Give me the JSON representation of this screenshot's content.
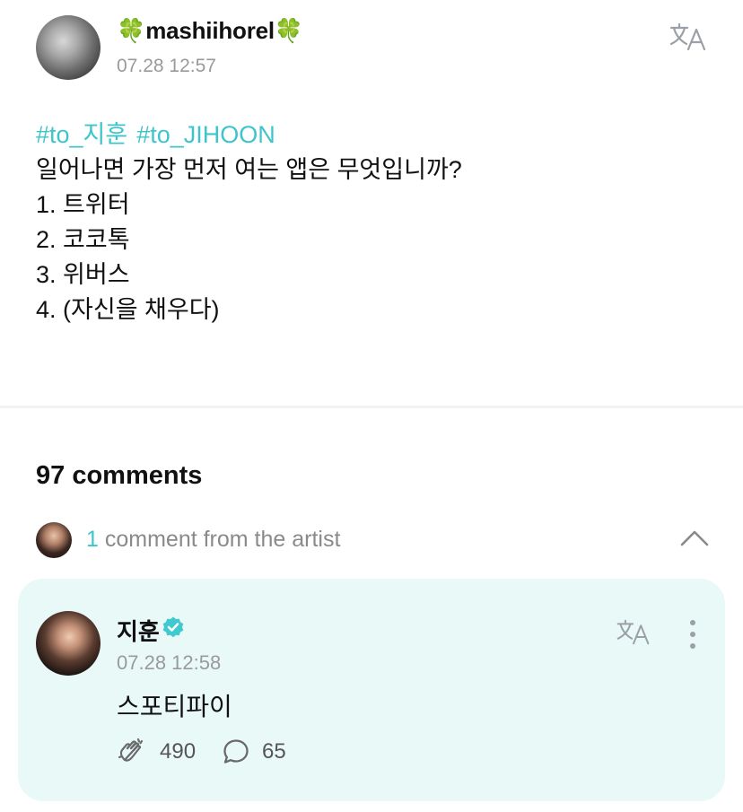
{
  "post": {
    "author": {
      "name": "mashiihorel",
      "emoji_left": "🍀",
      "emoji_right": "🍀"
    },
    "timestamp": "07.28 12:57",
    "hashtags": [
      "#to_지훈",
      "#to_JIHOON"
    ],
    "lines": [
      "일어나면 가장 먼저 여는 앱은 무엇입니까?",
      "1. 트위터",
      "2. 코코톡",
      "3. 위버스",
      "4. (자신을 채우다)"
    ],
    "translate_icon": "translate-icon"
  },
  "comments": {
    "count_label": "97 comments",
    "artist_summary": {
      "count": "1",
      "label": "comment from the artist"
    },
    "artist_comment": {
      "author": "지훈",
      "verified_icon": "verified-badge-icon",
      "timestamp": "07.28 12:58",
      "text": "스포티파이",
      "likes": "490",
      "replies": "65"
    }
  },
  "colors": {
    "accent": "#3ec5cc",
    "card_background": "#e9f9f8",
    "muted_text": "#9a9a9a"
  }
}
